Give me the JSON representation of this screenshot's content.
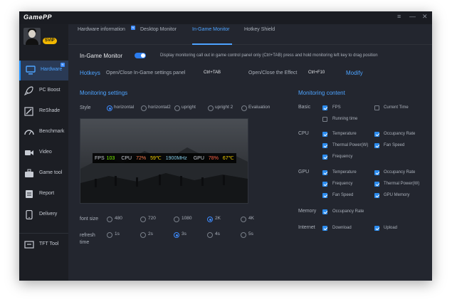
{
  "app": {
    "title": "GamePP",
    "vip_badge": "SVIP",
    "window_controls": {
      "menu": "≡",
      "minimize": "—",
      "close": "✕"
    }
  },
  "sidebar": {
    "items": [
      {
        "label": "Hardware",
        "icon": "monitor-icon",
        "active": true,
        "new": true
      },
      {
        "label": "PC Boost",
        "icon": "rocket-icon"
      },
      {
        "label": "ReShade",
        "icon": "reshade-icon"
      },
      {
        "label": "Benchmark",
        "icon": "gauge-icon"
      },
      {
        "label": "Video",
        "icon": "video-icon"
      },
      {
        "label": "Game tool",
        "icon": "toolbox-icon"
      },
      {
        "label": "Report",
        "icon": "report-icon"
      },
      {
        "label": "Delivery",
        "icon": "phone-icon"
      },
      {
        "label": "TFT Tool",
        "icon": "tft-icon"
      }
    ]
  },
  "tabs": [
    {
      "label": "Hardware information",
      "new": true
    },
    {
      "label": "Desktop Monitor"
    },
    {
      "label": "In-Game Monitor",
      "active": true
    },
    {
      "label": "Hotkey Shield"
    }
  ],
  "monitor": {
    "label": "In-Game Monitor",
    "enabled": true,
    "description": "Display monitoring call out in game control panel only (Ctrl+TAB) press and hold monitoring left key to drag position"
  },
  "hotkeys": {
    "label": "Hotkeys",
    "open_settings_label": "Open/Close In-Game settings panel",
    "open_settings_key": "Ctrl+TAB",
    "effect_label": "Open/Close the Effect",
    "effect_key": "Ctrl+F10",
    "modify": "Modify"
  },
  "settings": {
    "heading": "Monitoring settings",
    "style_label": "Style",
    "styles": [
      "horizontal",
      "horizontal2",
      "upright",
      "upright 2",
      "Evaluation"
    ],
    "style_selected": 0,
    "font_size_label": "font size",
    "font_sizes": [
      "480",
      "720",
      "1080",
      "2K",
      "4K"
    ],
    "font_size_selected": 3,
    "refresh_label": "refresh time",
    "refresh_times": [
      "1s",
      "2s",
      "3s",
      "4s",
      "5s"
    ],
    "refresh_selected": 2
  },
  "overlay": {
    "fps_label": "FPS",
    "fps_value": "103",
    "cpu_label": "CPU",
    "cpu_usage": "72%",
    "cpu_temp": "59℃",
    "cpu_freq": "1900MHz",
    "gpu_label": "GPU",
    "gpu_usage": "78%",
    "gpu_temp": "67℃"
  },
  "content": {
    "heading": "Monitoring content",
    "basic_label": "Basic",
    "basic": [
      {
        "label": "FPS",
        "checked": true
      },
      {
        "label": "Current Time",
        "checked": false
      },
      {
        "label": "Running time",
        "checked": false
      }
    ],
    "cpu_label": "CPU",
    "cpu": [
      {
        "label": "Temperature",
        "checked": true
      },
      {
        "label": "Occupancy Rate",
        "checked": true
      },
      {
        "label": "Thermal Power(W)",
        "checked": true
      },
      {
        "label": "Fan Speed",
        "checked": true
      },
      {
        "label": "Frequency",
        "checked": true
      }
    ],
    "gpu_label": "GPU",
    "gpu": [
      {
        "label": "Temperature",
        "checked": true
      },
      {
        "label": "Occupancy Rate",
        "checked": true
      },
      {
        "label": "Frequency",
        "checked": true
      },
      {
        "label": "Thermal Power(W)",
        "checked": true
      },
      {
        "label": "Fan Speed",
        "checked": true
      },
      {
        "label": "GPU Memory",
        "checked": true
      }
    ],
    "memory_label": "Memory",
    "memory": [
      {
        "label": "Occupancy Rate",
        "checked": true
      }
    ],
    "internet_label": "Internet",
    "internet": [
      {
        "label": "Download",
        "checked": true
      },
      {
        "label": "Upload",
        "checked": true
      }
    ]
  },
  "colors": {
    "accent": "#4da3ff",
    "background": "#23262f",
    "sidebar": "#1c1e24",
    "fps": "#7cfc00",
    "cpu_usage": "#ff7f50",
    "cpu_temp": "#ffd700",
    "gpu_usage": "#ff6347"
  }
}
